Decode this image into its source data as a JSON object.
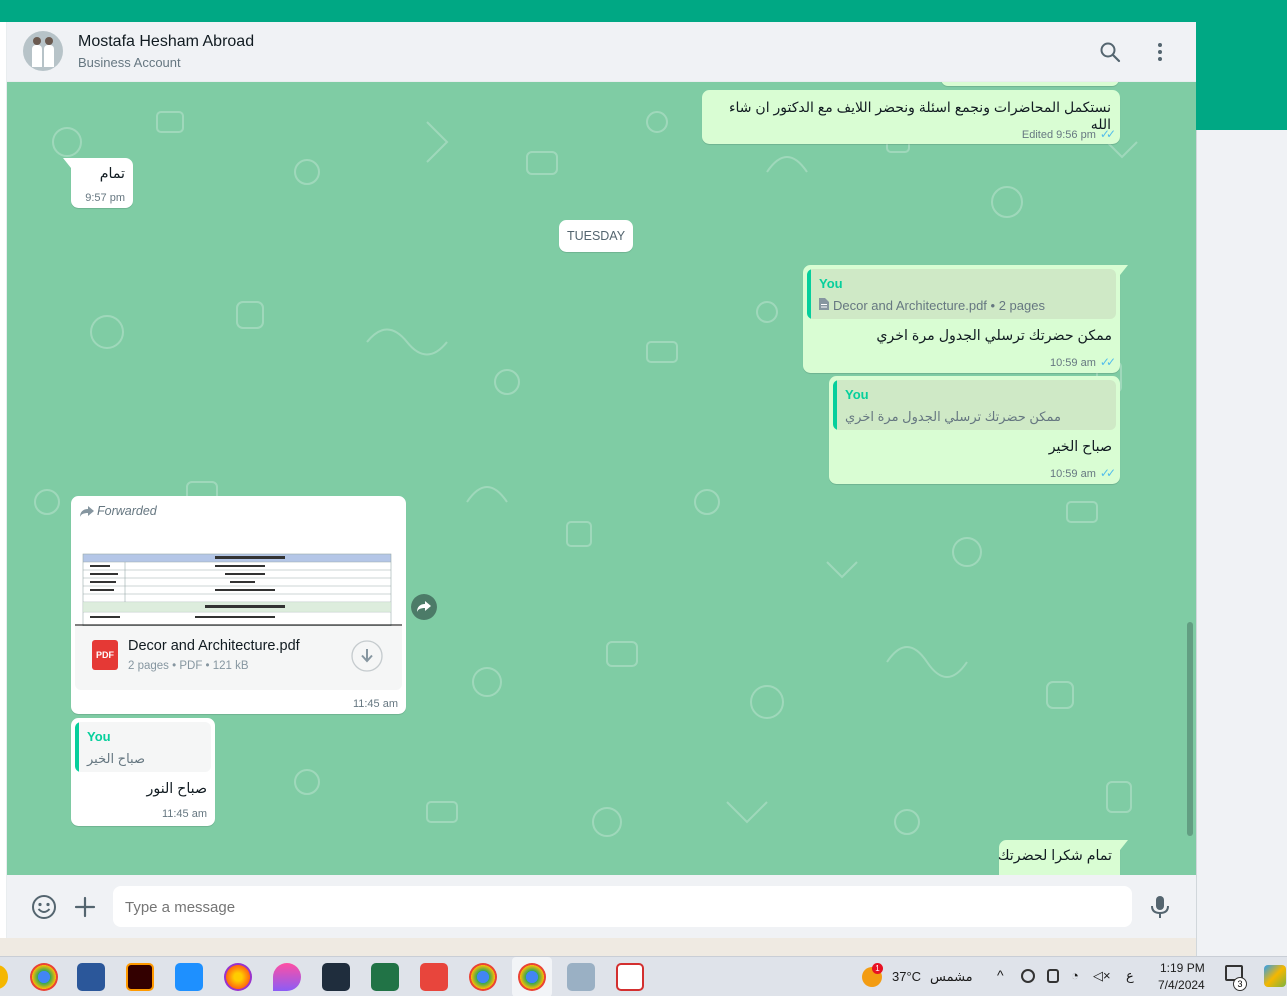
{
  "chat_header": {
    "contact_name": "Mostafa Hesham Abroad",
    "contact_subtitle": "Business Account"
  },
  "messages": {
    "m1": {
      "text": "نستكمل المحاضرات ونجمع اسئلة ونحضر اللايف  مع الدكتور ان شاء الله",
      "meta": "Edited 9:56 pm"
    },
    "m2": {
      "text": "تمام",
      "time": "9:57 pm"
    },
    "day_separator": "TUESDAY",
    "m3": {
      "quote_author": "You",
      "quote_doc": "Decor and Architecture.pdf • 2 pages",
      "text": "ممكن حضرتك ترسلي الجدول مرة اخري",
      "time": "10:59 am"
    },
    "m4": {
      "quote_author": "You",
      "quote_text": "ممكن حضرتك ترسلي الجدول مرة اخري",
      "text": "صباح الخير",
      "time": "10:59 am"
    },
    "m5": {
      "forwarded_label": "Forwarded",
      "file_name": "Decor and Architecture.pdf",
      "file_meta": "2 pages • PDF • 121 kB",
      "file_badge": "PDF",
      "time": "11:45 am"
    },
    "m6": {
      "quote_author": "You",
      "quote_text": "صباح الخير",
      "text": "صباح النور",
      "time": "11:45 am"
    },
    "m7": {
      "text": "تمام شكرا لحضرتك"
    }
  },
  "composer": {
    "placeholder": "Type a message"
  },
  "taskbar": {
    "weather_temp": "37°C",
    "weather_text": "مشمس",
    "weather_badge": "1",
    "lang": "ع",
    "time": "1:19 PM",
    "date": "7/4/2024",
    "notif_count": "3"
  },
  "colors": {
    "accent": "#00a884",
    "wallpaper": "#7fcca4",
    "outgoing_bubble": "#d9fdd3",
    "incoming_bubble": "#ffffff",
    "read_ticks": "#53bdeb",
    "quote_author": "#06cf9c"
  }
}
